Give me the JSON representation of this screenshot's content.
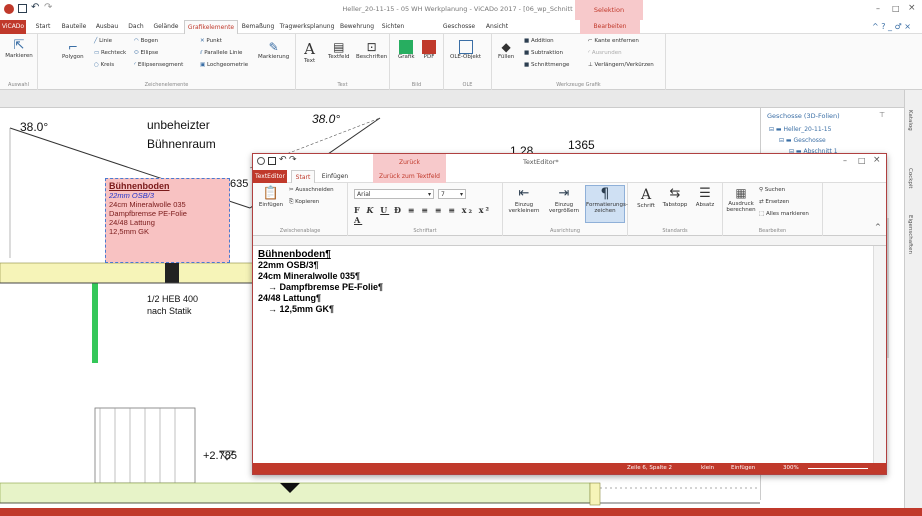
{
  "app": {
    "title": "Heller_20-11-15 - 05 WH Werkplanung - ViCADo 2017 - [06_wp_Schnitt a-a]",
    "context_tab": "Selektion"
  },
  "menu": {
    "tabs": [
      "ViCADo",
      "Start",
      "Bauteile",
      "Ausbau",
      "Dach",
      "Gelände",
      "Grafikelemente",
      "Bemaßung",
      "Tragwerksplanung",
      "Bewehrung",
      "Sichten",
      "Geschosse",
      "Ansicht",
      "Bearbeiten"
    ],
    "active": "Grafikelemente"
  },
  "ribbon": {
    "auswahl": {
      "btn": "Markieren",
      "label": "Auswahl"
    },
    "zeichen": {
      "polygon": "Polygon",
      "linie": "Linie",
      "rechteck": "Rechteck",
      "kreis": "Kreis",
      "bogen": "Bogen",
      "ellipse": "Ellipse",
      "ellipsensegment": "Ellipsensegment",
      "punkt": "Punkt",
      "parallele": "Parallele Linie",
      "lochgeometrie": "Lochgeometrie",
      "markierung": "Markierung",
      "label": "Zeichenelemente"
    },
    "text": {
      "text": "Text",
      "textfeld": "Textfeld",
      "beschriften": "Beschriften",
      "label": "Text"
    },
    "bild": {
      "grafik": "Grafik",
      "pdf": "PDF",
      "label": "Bild"
    },
    "ole": {
      "obj": "OLE-Objekt",
      "label": "OLE"
    },
    "werkzeuge": {
      "fuellen": "Füllen",
      "addition": "Addition",
      "subtraktion": "Subtraktion",
      "schnittmenge": "Schnittmenge",
      "kante": "Kante entfernen",
      "ausrunden": "Ausrunden",
      "verlaengern": "Verlängern/Verkürzen",
      "label": "Werkzeuge Grafik"
    }
  },
  "drawing": {
    "angle1": "38.0°",
    "angle2": "38.0°",
    "attic1": "unbeheizter",
    "attic2": "Bühnenraum",
    "dim1": "1.28",
    "dim2": "1365",
    "beam1": "1/2 HEB 400",
    "beam2": "nach Statik",
    "level": "+2.785",
    "dim3": "635",
    "note": {
      "title": "Bühnenboden",
      "l1": "22mm OSB/3",
      "l2": "24cm Mineralwolle 035",
      "l3": "Dampfbremse PE-Folie",
      "l4": "24/48 Lattung",
      "l5": "12,5mm GK"
    }
  },
  "panel": {
    "title": "Geschosse (3D-Folien)",
    "root": "Heller_20-11-15",
    "n1": "Geschosse",
    "n2": "Abschnitt 1",
    "pin": "⊼"
  },
  "vtabs": [
    "Katalog",
    "Cockpit",
    "Eigenschaften"
  ],
  "editor": {
    "title": "TextEditor*",
    "ctx": "Zurück",
    "tabs": [
      "TextEditor",
      "Start",
      "Einfügen",
      "Zurück zum Textfeld"
    ],
    "paste": "Einfügen",
    "cut": "Ausschneiden",
    "copy": "Kopieren",
    "clip_label": "Zwischenablage",
    "font": "Arial",
    "size": "7",
    "font_label": "Schriftart",
    "indent_less": "Einzug verkleinern",
    "indent_more": "Einzug vergrößern",
    "format": "Formatierungs-zeichen",
    "para_label": "Ausrichtung",
    "schrift": "Schrift",
    "tabstopp": "Tabstopp",
    "absatz": "Absatz",
    "std_label": "Standards",
    "ausdruck": "Ausdruck berechnen",
    "suchen": "Suchen",
    "ersetzen": "Ersetzen",
    "alles": "Alles markieren",
    "bearb_label": "Bearbeiten",
    "lines": [
      "Bühnenboden¶",
      "22mm OSB/3¶",
      "24cm Mineralwolle 035¶",
      "→ Dampfbremse PE-Folie¶",
      "24/48 Lattung¶",
      "→ 12,5mm GK¶"
    ],
    "status": {
      "pos": "Zeile 6, Spalte 2",
      "mode": "klein",
      "ins": "Einfügen",
      "zoom": "300%"
    }
  }
}
